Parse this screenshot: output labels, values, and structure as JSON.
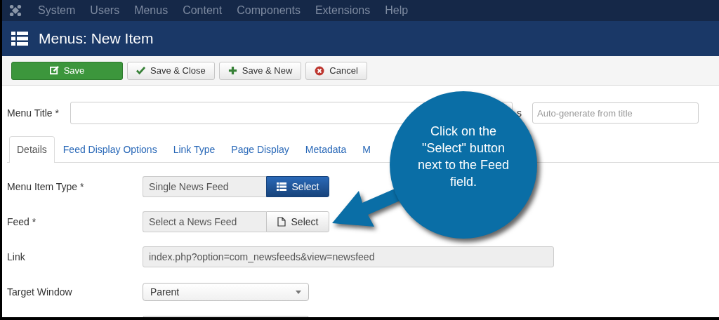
{
  "menu_bar": {
    "items": [
      "System",
      "Users",
      "Menus",
      "Content",
      "Components",
      "Extensions",
      "Help"
    ]
  },
  "header": {
    "title": "Menus: New Item"
  },
  "toolbar": {
    "buttons": [
      {
        "label": "Save",
        "kind": "primary"
      },
      {
        "label": "Save & Close",
        "kind": "check"
      },
      {
        "label": "Save & New",
        "kind": "plus"
      },
      {
        "label": "Cancel",
        "kind": "cancel"
      }
    ]
  },
  "title_row": {
    "label": "Menu Title *",
    "alias_label": "s",
    "alias_placeholder": "Auto-generate from title"
  },
  "tabs": [
    {
      "label": "Details",
      "selected": true
    },
    {
      "label": "Feed Display Options",
      "selected": false
    },
    {
      "label": "Link Type",
      "selected": false
    },
    {
      "label": "Page Display",
      "selected": false
    },
    {
      "label": "Metadata",
      "selected": false
    },
    {
      "label": "M",
      "selected": false
    }
  ],
  "fields": [
    {
      "label": "Menu Item Type *",
      "kind": "picker",
      "value": "Single News Feed",
      "button": "Select",
      "primary": true
    },
    {
      "label": "Feed *",
      "kind": "picker",
      "value": "Select a News Feed",
      "button": "Select",
      "primary": false
    },
    {
      "label": "Link",
      "kind": "readonly",
      "value": "index.php?option=com_newsfeeds&view=newsfeed"
    },
    {
      "label": "Target Window",
      "kind": "select",
      "value": "Parent"
    },
    {
      "kind": "partial"
    }
  ],
  "callout": {
    "text": "Click on the \"Select\" button next to the Feed field."
  }
}
